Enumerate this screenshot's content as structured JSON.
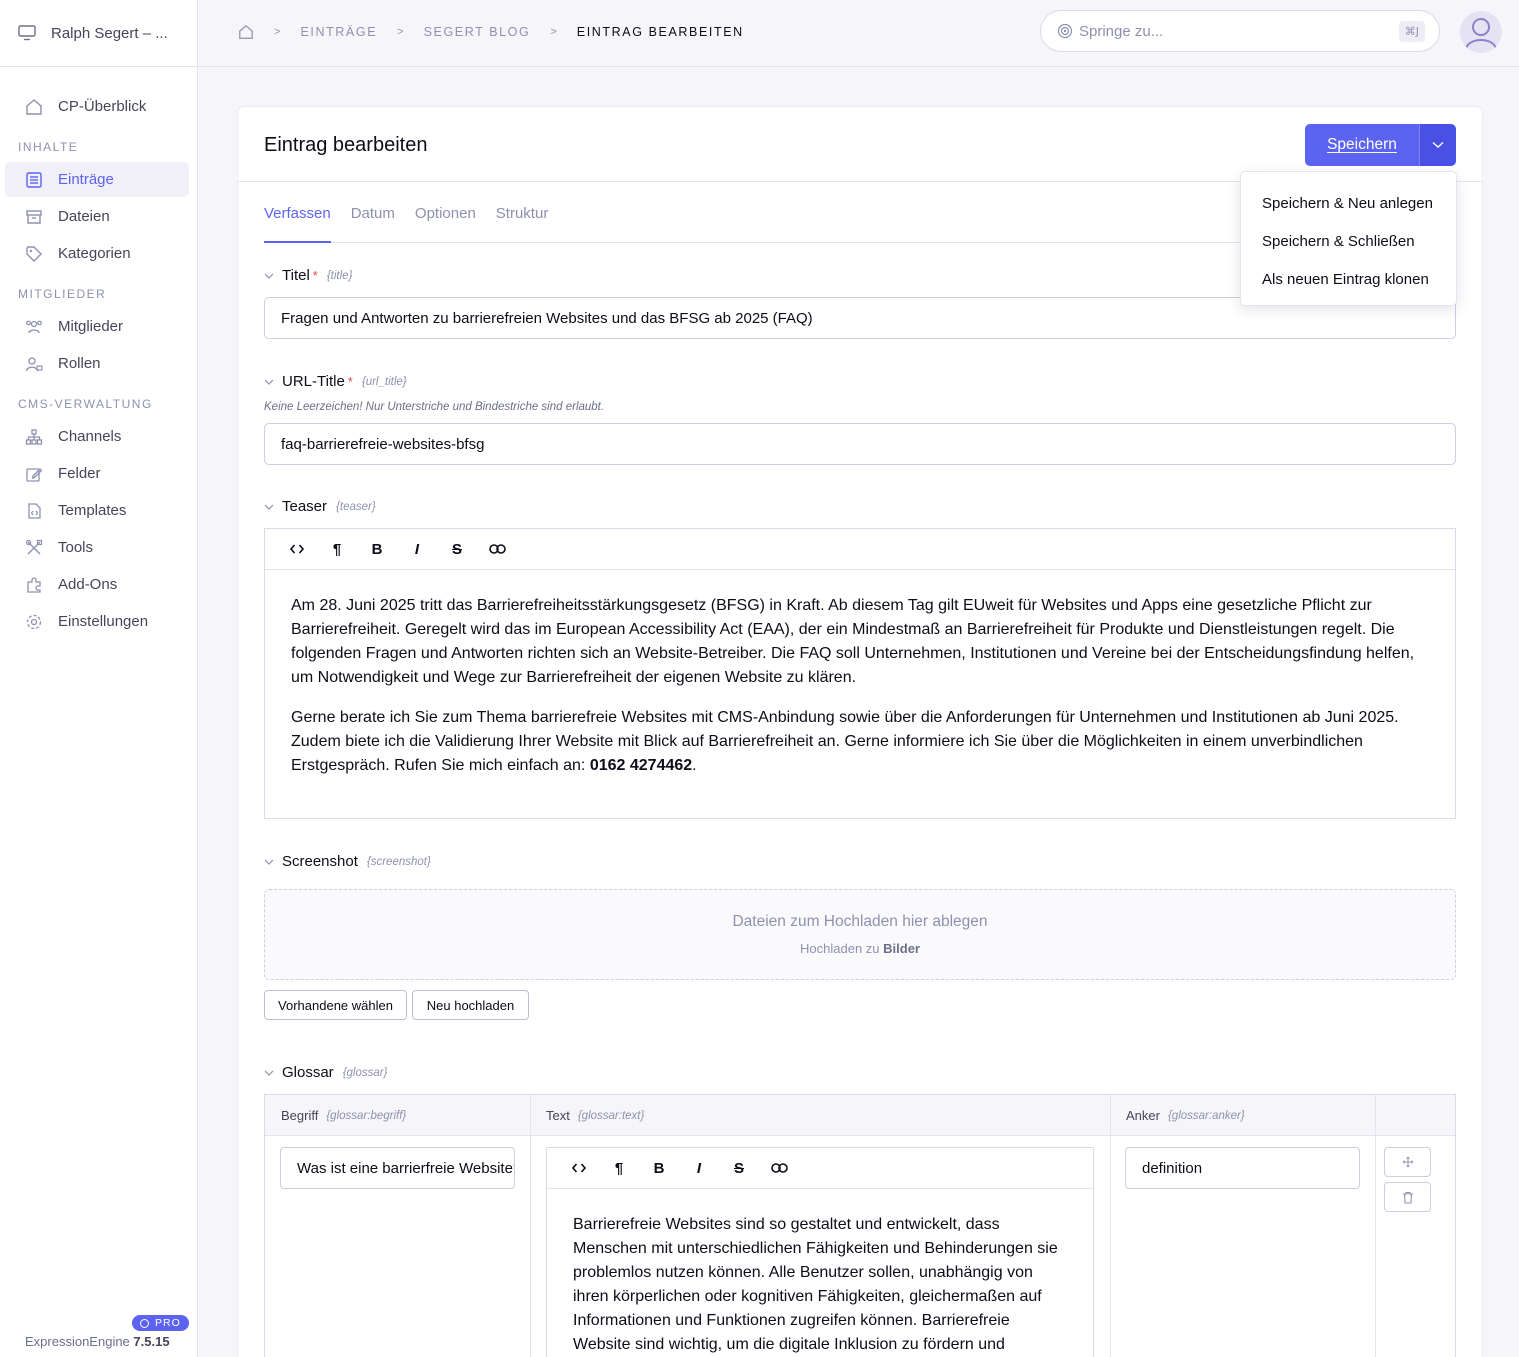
{
  "site": {
    "name": "Ralph Segert – ..."
  },
  "sidebar": {
    "overview": "CP-Überblick",
    "sections": [
      {
        "title": "INHALTE",
        "items": [
          "Einträge",
          "Dateien",
          "Kategorien"
        ]
      },
      {
        "title": "MITGLIEDER",
        "items": [
          "Mitglieder",
          "Rollen"
        ]
      },
      {
        "title": "CMS-VERWALTUNG",
        "items": [
          "Channels",
          "Felder",
          "Templates",
          "Tools",
          "Add-Ons",
          "Einstellungen"
        ]
      }
    ],
    "footer": {
      "product": "ExpressionEngine",
      "version": "7.5.15",
      "badge": "PRO"
    }
  },
  "breadcrumb": {
    "items": [
      "EINTRÄGE",
      "SEGERT BLOG"
    ],
    "current": "EINTRAG BEARBEITEN",
    "separator": ">"
  },
  "jump": {
    "placeholder": "Springe zu...",
    "shortcut": "⌘J"
  },
  "panel": {
    "title": "Eintrag bearbeiten",
    "save_label": "Speichern",
    "save_menu": [
      "Speichern & Neu anlegen",
      "Speichern & Schließen",
      "Als neuen Eintrag klonen"
    ],
    "tabs": [
      "Verfassen",
      "Datum",
      "Optionen",
      "Struktur"
    ]
  },
  "fields": {
    "title": {
      "label": "Titel",
      "short": "{title}",
      "value": "Fragen und Antworten zu barrierefreien Websites und das BFSG ab 2025 (FAQ)"
    },
    "url_title": {
      "label": "URL-Title",
      "short": "{url_title}",
      "instructions": "Keine Leerzeichen! Nur Unterstriche und Bindestriche sind erlaubt.",
      "value": "faq-barrierefreie-websites-bfsg"
    },
    "teaser": {
      "label": "Teaser",
      "short": "{teaser}",
      "p1": "Am 28. Juni 2025 tritt das Barrierefreiheitsstärkungsgesetz (BFSG) in Kraft. Ab diesem Tag gilt EUweit für Websites und Apps eine gesetzliche Pflicht zur Barrierefreiheit. Geregelt wird das im European Accessibility Act (EAA), der ein Mindestmaß an Barrierefreiheit für Produkte und Dienstleistungen regelt. Die folgenden Fragen und Antworten richten sich an Website-Betreiber. Die FAQ soll Unternehmen, Institutionen und Vereine bei der Entscheidungsfindung helfen, um Notwendigkeit und Wege zur Barrierefreiheit der eigenen Website zu klären.",
      "p2_text": "Gerne berate ich Sie zum Thema barrierefreie Websites mit CMS-Anbindung sowie über die Anforderungen für Unternehmen und Institutionen ab Juni 2025. Zudem biete ich die Validierung Ihrer Website mit Blick auf Barrierefreiheit an. Gerne informiere ich Sie über die Möglichkeiten in einem unverbindlichen Erstgespräch. Rufen Sie mich einfach an: ",
      "p2_phone": "0162 4274462",
      "p2_end": "."
    },
    "screenshot": {
      "label": "Screenshot",
      "short": "{screenshot}",
      "drop_text": "Dateien zum Hochladen hier ablegen",
      "upload_prefix": "Hochladen zu ",
      "upload_target": "Bilder",
      "choose_existing": "Vorhandene wählen",
      "upload_new": "Neu hochladen"
    },
    "glossar": {
      "label": "Glossar",
      "short": "{glossar}",
      "columns": [
        {
          "label": "Begriff",
          "short": "{glossar:begriff}"
        },
        {
          "label": "Text",
          "short": "{glossar:text}"
        },
        {
          "label": "Anker",
          "short": "{glossar:anker}"
        }
      ],
      "row": {
        "begriff": "Was ist eine barrierfreie Website?",
        "text": "Barrierefreie Websites sind so gestaltet und entwickelt, dass Menschen mit unterschiedlichen Fähigkeiten und Behinderungen sie problemlos nutzen können. Alle Benutzer sollen, unabhängig von ihren körperlichen oder kognitiven Fähigkeiten, gleichermaßen auf Informationen und Funktionen zugreifen können. Barrierefreie Website sind wichtig, um die digitale Inklusion zu fördern und",
        "anker": "definition"
      }
    }
  },
  "rte_toolbar": {
    "code": "<>",
    "paragraph": "¶",
    "bold": "B",
    "italic": "I",
    "strike": "S"
  },
  "colors": {
    "accent": "#5D63F1",
    "required": "#e64a4a"
  }
}
